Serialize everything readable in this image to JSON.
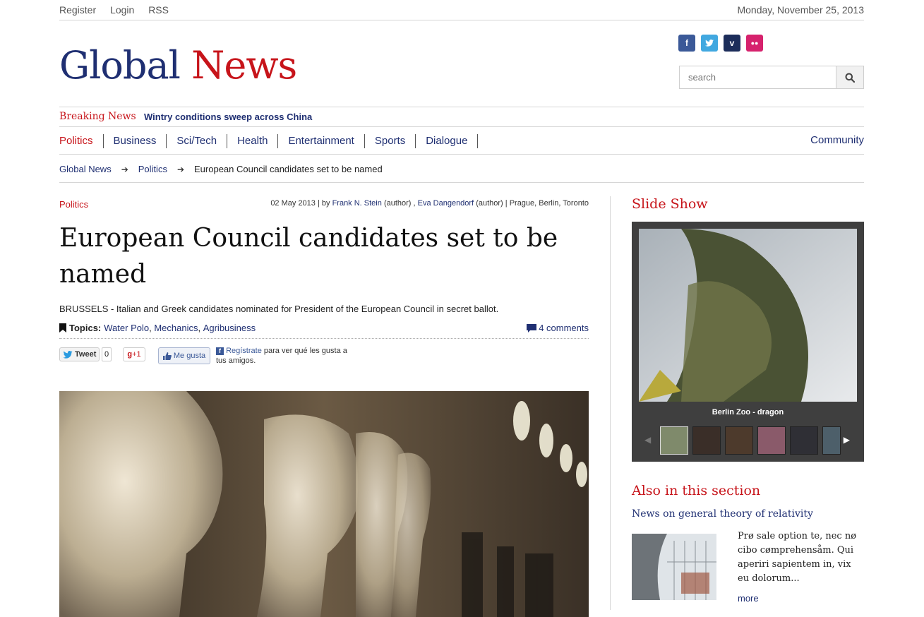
{
  "topbar": {
    "register": "Register",
    "login": "Login",
    "rss": "RSS",
    "date": "Monday, November 25, 2013"
  },
  "header": {
    "logo_part1": "Global",
    "logo_part2": "News",
    "search_placeholder": "search",
    "social": [
      {
        "icon": "facebook-icon",
        "glyph": "f",
        "color": "#3b5998"
      },
      {
        "icon": "twitter-icon",
        "glyph": "t",
        "color": "#41a8e0"
      },
      {
        "icon": "vimeo-icon",
        "glyph": "v",
        "color": "#1c2d5a"
      },
      {
        "icon": "flickr-icon",
        "glyph": "••",
        "color": "#d6226d"
      }
    ]
  },
  "breaking": {
    "label": "Breaking News",
    "text": "Wintry conditions sweep across China"
  },
  "nav": {
    "items": [
      "Politics",
      "Business",
      "Sci/Tech",
      "Health",
      "Entertainment",
      "Sports",
      "Dialogue"
    ],
    "community": "Community"
  },
  "breadcrumb": {
    "home": "Global News",
    "section": "Politics",
    "current": "European Council candidates set to be named"
  },
  "article": {
    "section": "Politics",
    "date": "02 May 2013 | by",
    "author1": "Frank N. Stein",
    "author1_role": "(author) ,",
    "author2": "Eva Dangendorf",
    "author2_role": "(author) | Prague, Berlin, Toronto",
    "title": "European Council candidates set to be named",
    "lead": "BRUSSELS - Italian and Greek candidates nominated for President of the European Council in secret ballot.",
    "topics_label": "Topics:",
    "topics": [
      "Water Polo",
      "Mechanics",
      "Agribusiness"
    ],
    "comments": "4 comments",
    "share": {
      "tweet": "Tweet",
      "tweet_count": "0",
      "gplus": "+1",
      "like": "Me gusta",
      "fb_register": "Regístrate",
      "fb_text": "para ver qué les gusta a tus amigos."
    }
  },
  "sidebar": {
    "slideshow_title": "Slide Show",
    "slide_caption": "Berlin Zoo - dragon",
    "also_title": "Also in this section",
    "also_headline": "News on general theory of relativity",
    "also_text": "Prø sale option te, nec nø cibo cømprehensåm. Qui aperiri sapientem in, vix eu dolorum...",
    "also_more": "more"
  }
}
